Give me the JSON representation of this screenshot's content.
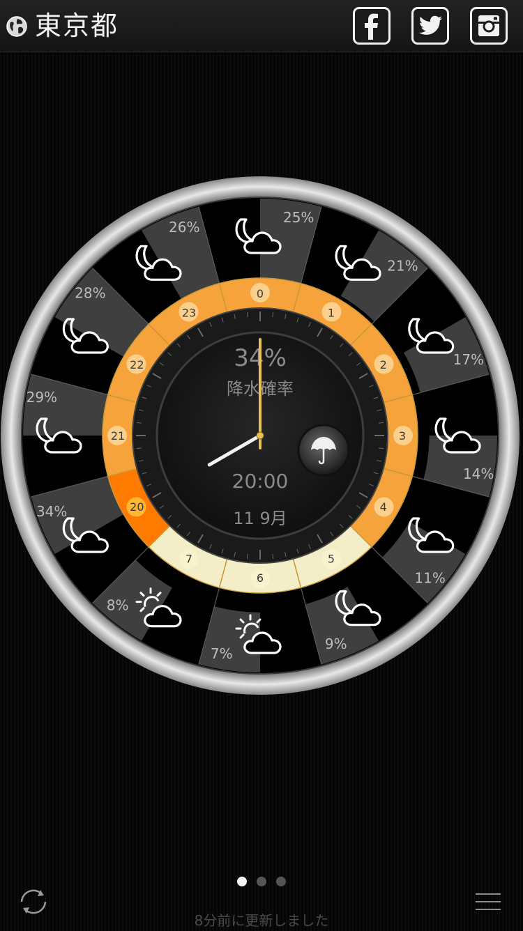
{
  "header": {
    "city": "東京都",
    "icons": [
      "globe-icon",
      "facebook-icon",
      "twitter-icon",
      "instagram-icon"
    ]
  },
  "clock": {
    "precip_value": "34%",
    "precip_label": "降水確率",
    "time": "20:00",
    "date": "11 9月",
    "umbrella_icon": "umbrella-icon",
    "clock_time": {
      "hour": 20,
      "minute": 0
    },
    "hours": [
      {
        "hour": "0",
        "icon": "moon-cloud-icon",
        "pop": "25%",
        "pop_value": 25
      },
      {
        "hour": "1",
        "icon": "moon-cloud-icon",
        "pop": "21%",
        "pop_value": 21
      },
      {
        "hour": "2",
        "icon": "moon-cloud-icon",
        "pop": "17%",
        "pop_value": 17
      },
      {
        "hour": "3",
        "icon": "moon-cloud-icon",
        "pop": "14%",
        "pop_value": 14
      },
      {
        "hour": "4",
        "icon": "moon-cloud-icon",
        "pop": "11%",
        "pop_value": 11
      },
      {
        "hour": "5",
        "icon": "moon-cloud-icon",
        "pop": "9%",
        "pop_value": 9
      },
      {
        "hour": "6",
        "icon": "sun-cloud-icon",
        "pop": "7%",
        "pop_value": 7
      },
      {
        "hour": "7",
        "icon": "sun-cloud-icon",
        "pop": "8%",
        "pop_value": 8
      },
      {
        "hour": "20",
        "icon": "moon-cloud-icon",
        "pop": "34%",
        "pop_value": 34
      },
      {
        "hour": "21",
        "icon": "moon-cloud-icon",
        "pop": "29%",
        "pop_value": 29
      },
      {
        "hour": "22",
        "icon": "moon-cloud-icon",
        "pop": "28%",
        "pop_value": 28
      },
      {
        "hour": "23",
        "icon": "moon-cloud-icon",
        "pop": "26%",
        "pop_value": 26
      }
    ],
    "current_hour": "20"
  },
  "pager": {
    "count": 3,
    "active": 0
  },
  "footer": {
    "updated_text": "8分前に更新しました",
    "refresh_icon": "refresh-icon",
    "menu_icon": "menu-icon"
  },
  "colors": {
    "ring_orange": "#f7a33b",
    "ring_highlight": "#ff7a00",
    "ring_pale": "#f3eec8",
    "pop_wedge": "#4b4b4b",
    "bezel": "#c8c8c8"
  }
}
